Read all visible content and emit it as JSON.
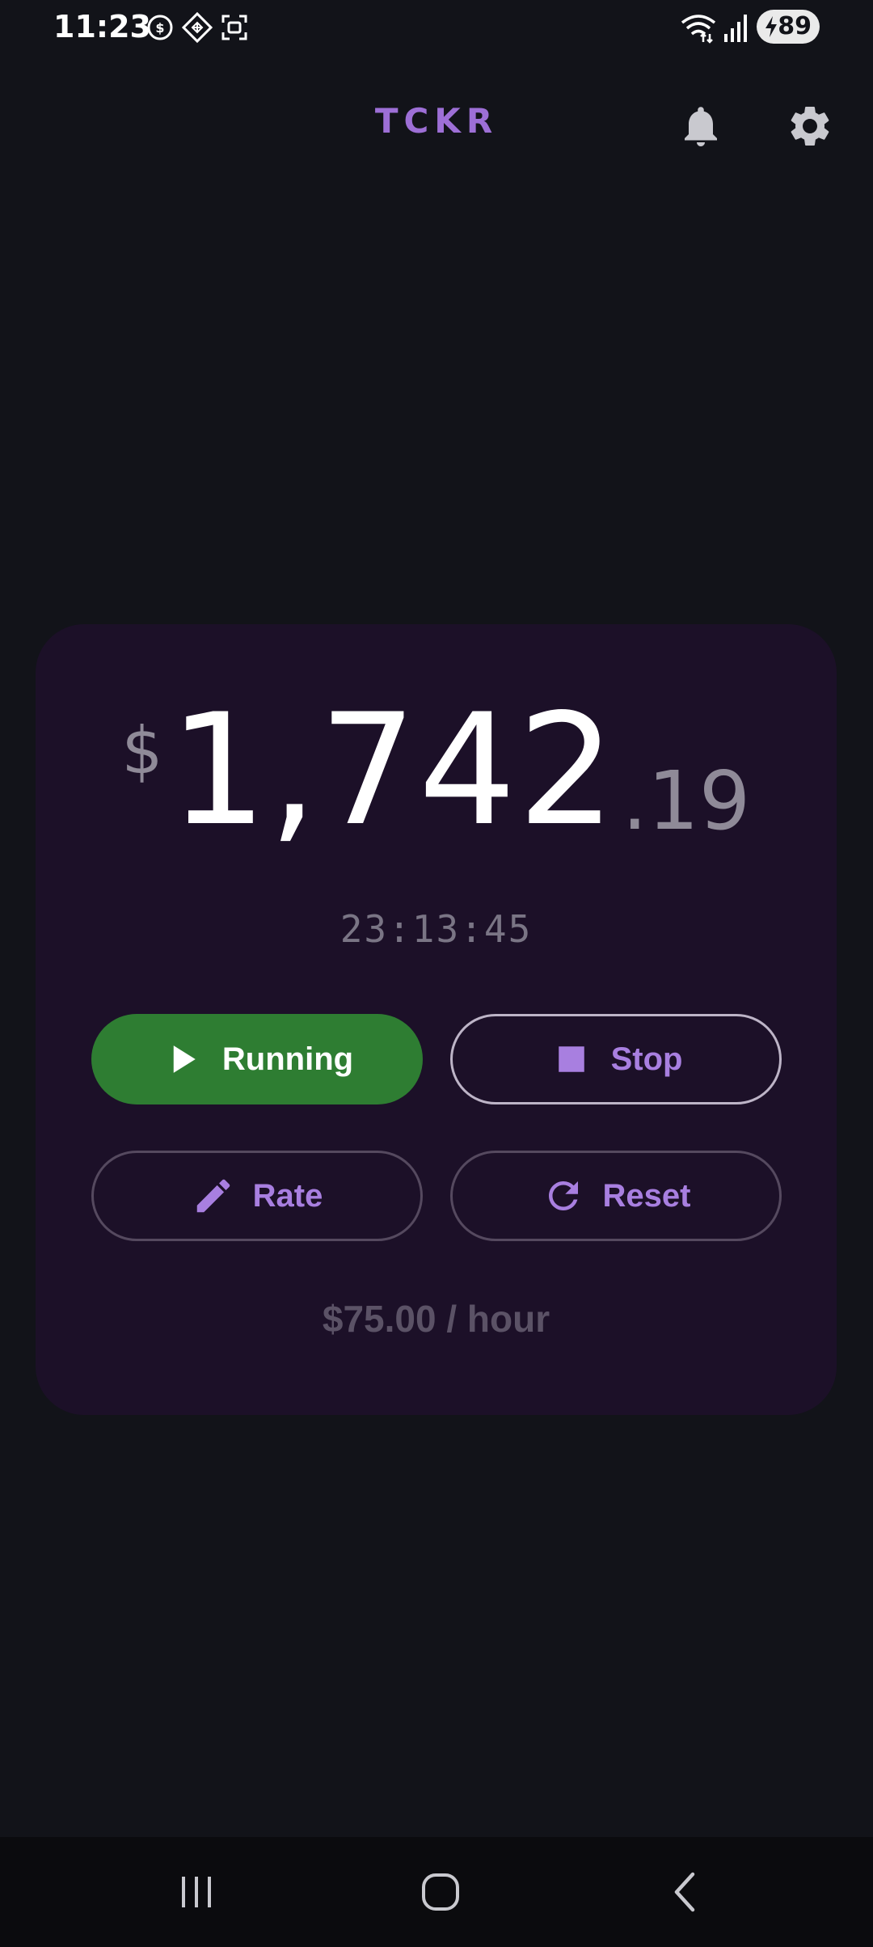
{
  "status_bar": {
    "time": "11:23",
    "battery_level": "89",
    "notification_icons": [
      "dollar-circle-icon",
      "diamond-grid-icon",
      "screenshot-icon"
    ],
    "system_icons": [
      "wifi-icon",
      "signal-icon",
      "battery-charging-icon"
    ]
  },
  "app_bar": {
    "title": "TCKR",
    "icons": [
      "bell-icon",
      "gear-icon"
    ]
  },
  "earnings": {
    "currency_symbol": "$",
    "whole": "1,742",
    "cents": ".19",
    "elapsed": "23:13:45"
  },
  "buttons": {
    "running_label": "Running",
    "stop_label": "Stop",
    "rate_label": "Rate",
    "reset_label": "Reset"
  },
  "rate_text": "$75.00 / hour",
  "colors": {
    "background": "#121319",
    "card": "#1c1028",
    "accent": "#a87fe0",
    "running": "#2e7d32",
    "muted": "#8f8a98"
  },
  "nav_bar": {
    "icons": [
      "recents-icon",
      "home-icon",
      "back-icon"
    ]
  }
}
